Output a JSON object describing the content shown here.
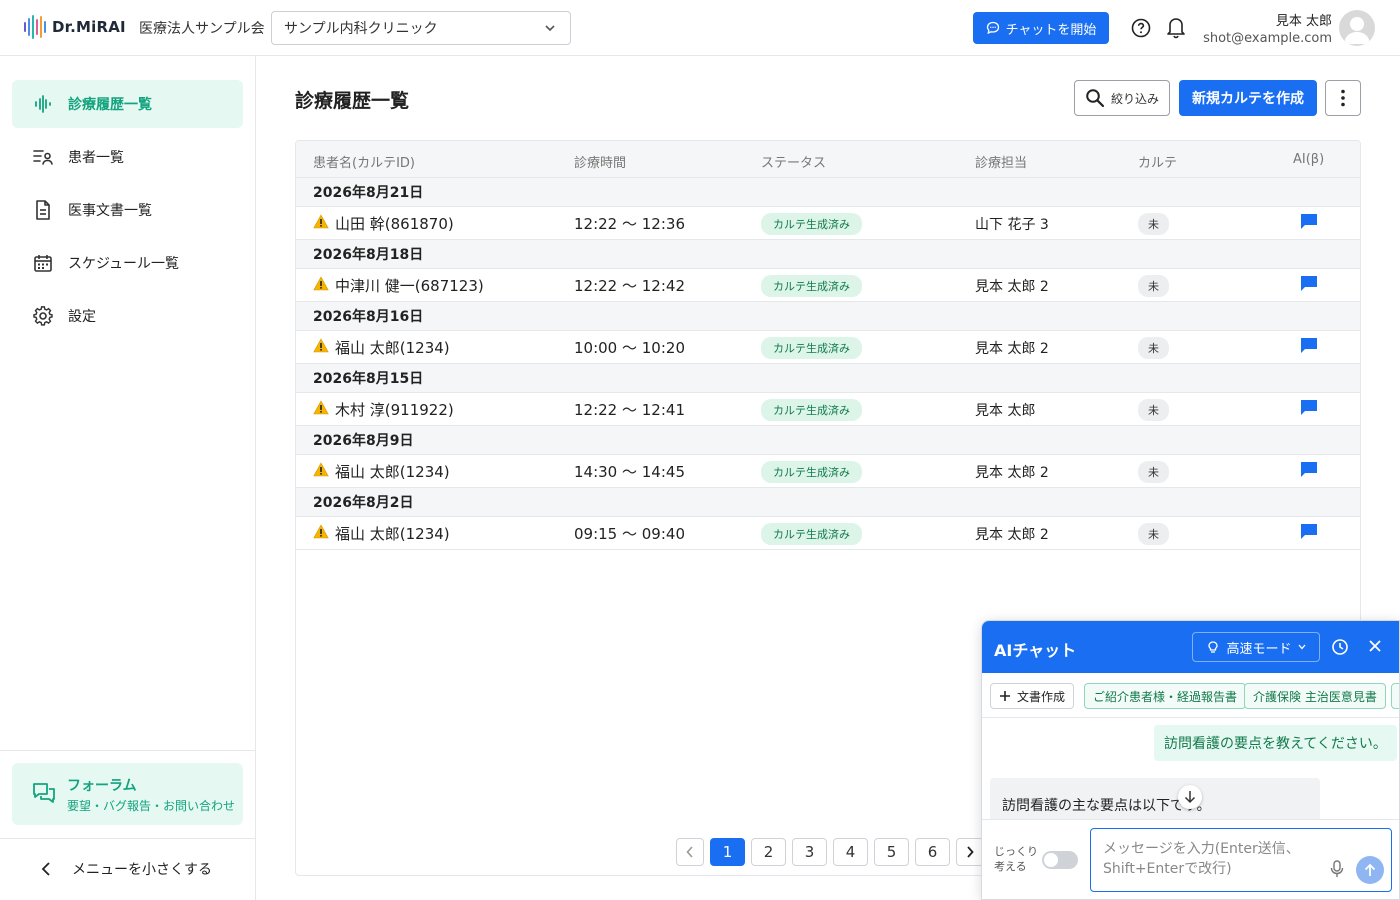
{
  "header": {
    "logo_text": "Dr.MiRAI",
    "org_name": "医療法人サンプル会",
    "clinic_select": "サンプル内科クリニック",
    "chat_start": "チャットを開始",
    "user_name": "見本 太郎",
    "user_email": "shot@example.com"
  },
  "sidebar": {
    "items": [
      {
        "label": "診療履歴一覧",
        "icon": "waveform-icon",
        "active": true
      },
      {
        "label": "患者一覧",
        "icon": "patient-list-icon"
      },
      {
        "label": "医事文書一覧",
        "icon": "document-icon"
      },
      {
        "label": "スケジュール一覧",
        "icon": "calendar-icon"
      },
      {
        "label": "設定",
        "icon": "gear-icon"
      }
    ],
    "forum_title": "フォーラム",
    "forum_sub": "要望・バグ報告・お問い合わせ",
    "collapse": "メニューを小さくする"
  },
  "main": {
    "title": "診療履歴一覧",
    "filter_label": "絞り込み",
    "new_label": "新規カルテを作成",
    "columns": [
      "患者名(カルテID)",
      "診療時間",
      "ステータス",
      "診療担当",
      "カルテ",
      "AI(β)"
    ],
    "groups": [
      {
        "date": "2026年8月21日",
        "patient": "山田 幹(861870)",
        "time": "12:22 〜 12:36",
        "status": "カルテ生成済み",
        "doctor": "山下 花子 3",
        "karte": "未"
      },
      {
        "date": "2026年8月18日",
        "patient": "中津川 健一(687123)",
        "time": "12:22 〜 12:42",
        "status": "カルテ生成済み",
        "doctor": "見本 太郎 2",
        "karte": "未"
      },
      {
        "date": "2026年8月16日",
        "patient": "福山 太郎(1234)",
        "time": "10:00 〜 10:20",
        "status": "カルテ生成済み",
        "doctor": "見本 太郎 2",
        "karte": "未"
      },
      {
        "date": "2026年8月15日",
        "patient": "木村 淳(911922)",
        "time": "12:22 〜 12:41",
        "status": "カルテ生成済み",
        "doctor": "見本 太郎",
        "karte": "未"
      },
      {
        "date": "2026年8月9日",
        "patient": "福山 太郎(1234)",
        "time": "14:30 〜 14:45",
        "status": "カルテ生成済み",
        "doctor": "見本 太郎 2",
        "karte": "未"
      },
      {
        "date": "2026年8月2日",
        "patient": "福山 太郎(1234)",
        "time": "09:15 〜 09:40",
        "status": "カルテ生成済み",
        "doctor": "見本 太郎 2",
        "karte": "未"
      }
    ],
    "pages": [
      "1",
      "2",
      "3",
      "4",
      "5",
      "6"
    ],
    "current_page": "1"
  },
  "chat": {
    "title": "AIチャット",
    "mode": "高速モード",
    "chips": [
      "文書作成",
      "ご紹介患者様・経過報告書",
      "介護保険 主治医意見書"
    ],
    "user_message": "訪問看護の要点を教えてください。",
    "ai_message": "訪問看護の主な要点は以下です。",
    "think_label_1": "じっくり",
    "think_label_2": "考える",
    "input_placeholder": "メッセージを入力(Enter送信、Shift+Enterで改行)"
  },
  "colors": {
    "primary": "#1a6ef2",
    "accent_green": "#14a37f",
    "warning": "#f5b400"
  }
}
